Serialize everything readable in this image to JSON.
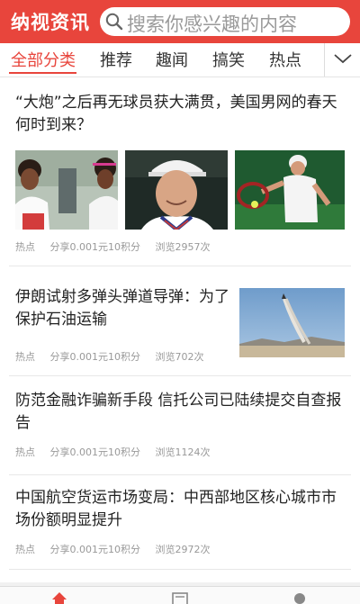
{
  "header": {
    "app_title": "纳视资讯",
    "search_placeholder": "搜索你感兴趣的内容",
    "accent_color": "#e8453c"
  },
  "tabs": [
    {
      "label": "全部分类",
      "active": true
    },
    {
      "label": "推荐"
    },
    {
      "label": "趣闻"
    },
    {
      "label": "搞笑"
    },
    {
      "label": "热点"
    }
  ],
  "articles": [
    {
      "title": "“大炮”之后再无球员获大满贯，美国男网的春天何时到来？",
      "tag": "热点",
      "share": "分享0.001元10积分",
      "views": "浏览2957次",
      "images": [
        "tennis-players-photo",
        "tennis-player-portrait-photo",
        "tennis-forehand-photo"
      ]
    },
    {
      "title": "伊朗试射多弹头弹道导弹：为了保护石油运输",
      "tag": "热点",
      "share": "分享0.001元10积分",
      "views": "浏览702次",
      "images": [
        "missile-launch-photo"
      ]
    },
    {
      "title": "防范金融诈骗新手段 信托公司已陆续提交自查报告",
      "tag": "热点",
      "share": "分享0.001元10积分",
      "views": "浏览1124次"
    },
    {
      "title": "中国航空货运市场变局：中西部地区核心城市市场份额明显提升",
      "tag": "热点",
      "share": "分享0.001元10积分",
      "views": "浏览2972次"
    }
  ],
  "bottom_nav": {
    "icons": [
      "home-icon",
      "news-icon",
      "profile-icon"
    ]
  }
}
